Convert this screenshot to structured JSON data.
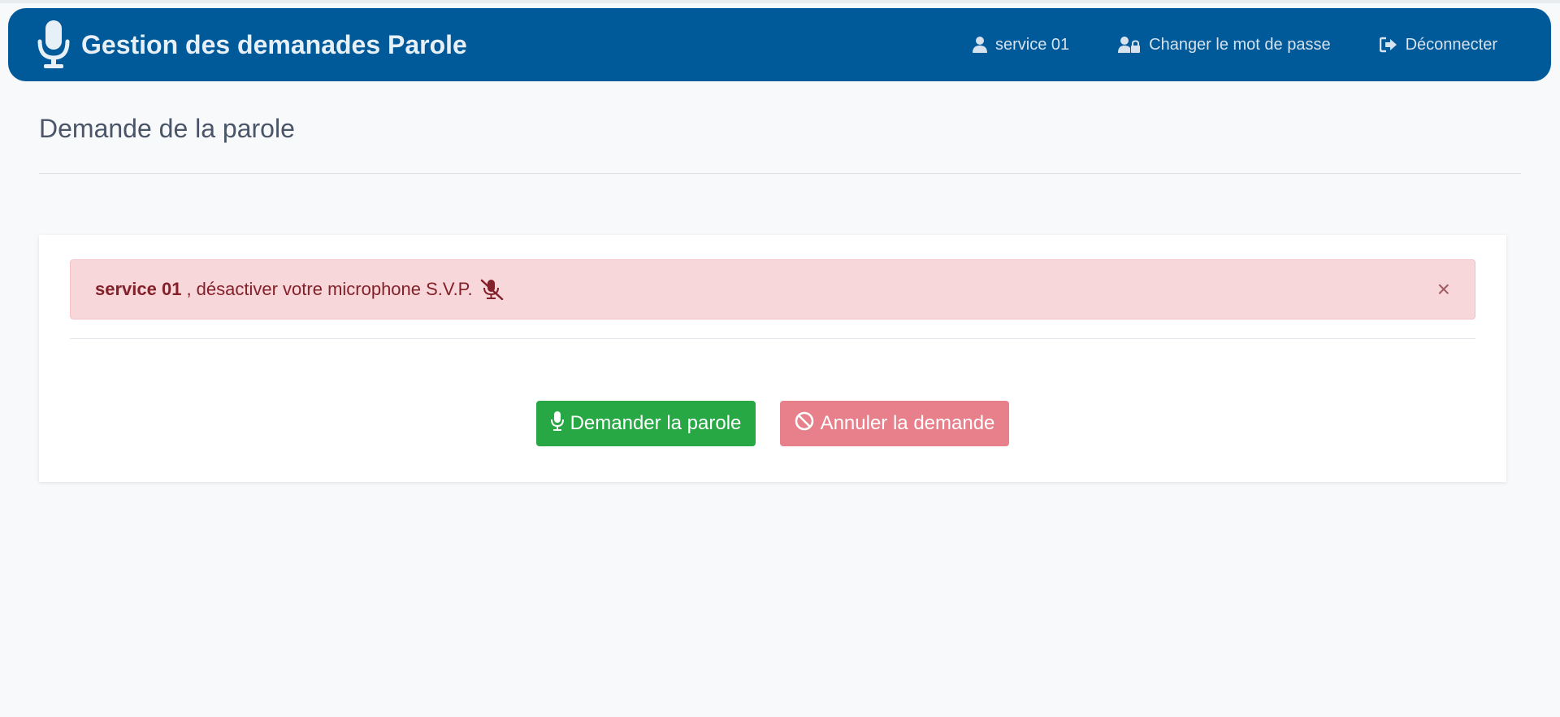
{
  "navbar": {
    "brand_title": "Gestion des demanades Parole",
    "brand_icon": "microphone-icon",
    "links": {
      "user": {
        "label": "service 01",
        "icon": "user-icon"
      },
      "password": {
        "label": "Changer le mot de passe",
        "icon": "user-lock-icon"
      },
      "logout": {
        "label": "Déconnecter",
        "icon": "sign-out-icon"
      }
    }
  },
  "page": {
    "title": "Demande de la parole"
  },
  "alert": {
    "user_name": "service 01",
    "message": ", désactiver votre microphone S.V.P.",
    "icon": "microphone-slash-icon",
    "close_label": "×"
  },
  "actions": {
    "request_label": "Demander la parole",
    "cancel_label": "Annuler la demande"
  },
  "colors": {
    "navbar": "#005999",
    "alert_bg": "#f8d7da",
    "alert_text": "#842029",
    "success": "#28a745",
    "danger_light": "#e8808c"
  }
}
